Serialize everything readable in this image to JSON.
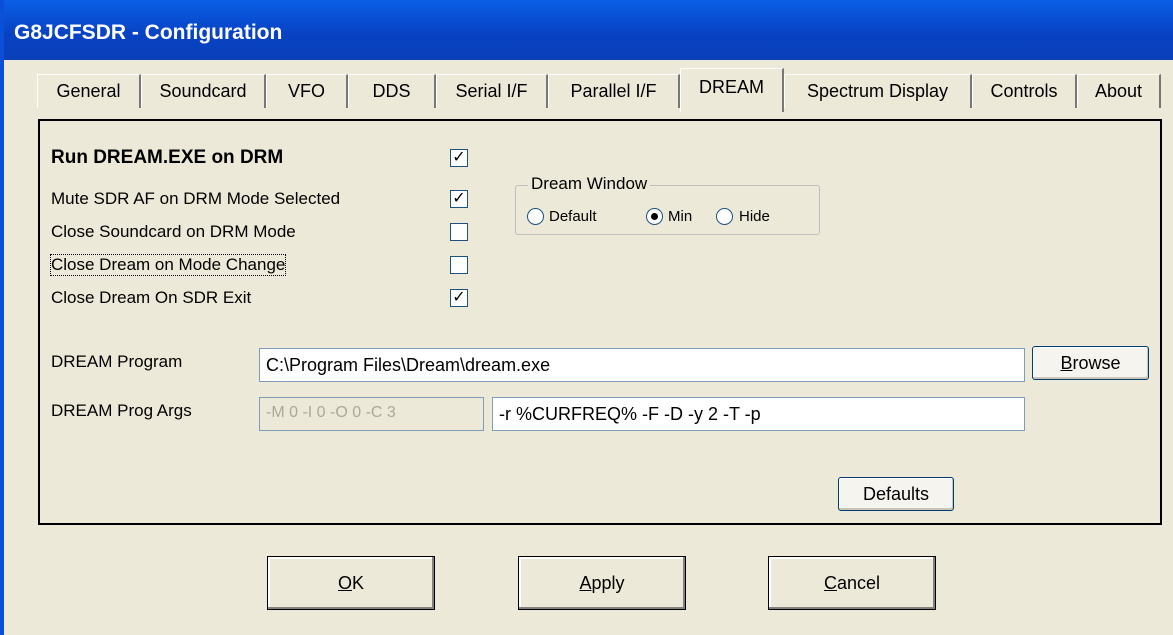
{
  "window": {
    "title": "G8JCFSDR - Configuration"
  },
  "tabs": [
    {
      "label": "General"
    },
    {
      "label": "Soundcard"
    },
    {
      "label": "VFO"
    },
    {
      "label": "DDS"
    },
    {
      "label": "Serial I/F"
    },
    {
      "label": "Parallel I/F"
    },
    {
      "label": "DREAM",
      "active": true
    },
    {
      "label": "Spectrum Display"
    },
    {
      "label": "Controls"
    },
    {
      "label": "About"
    }
  ],
  "dream": {
    "options": [
      {
        "label": "Run DREAM.EXE on DRM",
        "checked": true
      },
      {
        "label": "Mute SDR AF on DRM Mode Selected",
        "checked": true
      },
      {
        "label": "Close Soundcard on DRM Mode",
        "checked": false
      },
      {
        "label": "Close Dream on Mode Change",
        "checked": false
      },
      {
        "label": "Close Dream On SDR Exit",
        "checked": true
      }
    ],
    "window_group": {
      "legend": "Dream Window",
      "options": [
        {
          "label": "Default",
          "selected": false
        },
        {
          "label": "Min",
          "selected": true
        },
        {
          "label": "Hide",
          "selected": false
        }
      ]
    },
    "program": {
      "label": "DREAM Program",
      "value": "C:\\Program Files\\Dream\\dream.exe",
      "browse_label": "Browse",
      "browse_accel": "B",
      "browse_rest": "rowse"
    },
    "args": {
      "label": "DREAM Prog Args",
      "fixed_value": "-M 0 -I 0 -O 0 -C 3",
      "value": "-r %CURFREQ% -F -D -y 2 -T -p"
    },
    "defaults_label": "Defaults"
  },
  "footer": {
    "ok_accel": "O",
    "ok_rest": "K",
    "apply_accel": "A",
    "apply_rest": "pply",
    "cancel_accel": "C",
    "cancel_rest": "ancel"
  },
  "colors": {
    "title_bar": "#0a4fd8",
    "face": "#ece9d8"
  }
}
